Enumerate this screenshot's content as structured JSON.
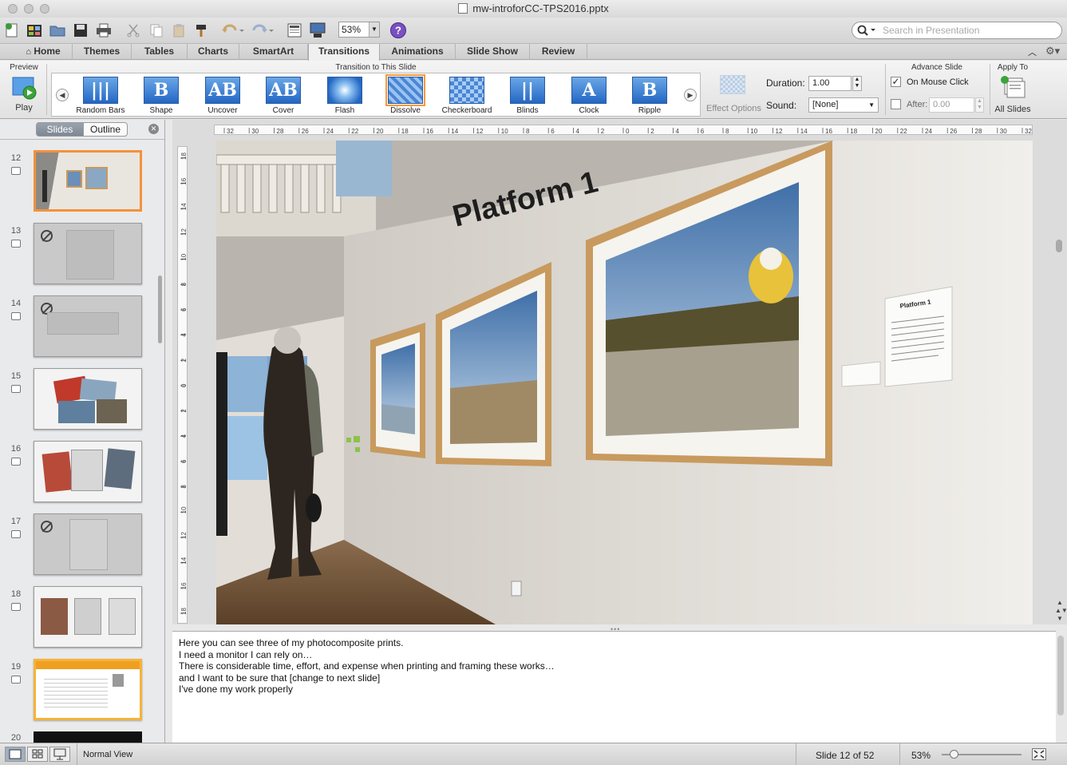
{
  "window": {
    "title": "mw-introforCC-TPS2016.pptx"
  },
  "toolbar": {
    "zoom": "53%",
    "search_placeholder": "Search in Presentation"
  },
  "tabs": [
    "Home",
    "Themes",
    "Tables",
    "Charts",
    "SmartArt",
    "Transitions",
    "Animations",
    "Slide Show",
    "Review"
  ],
  "active_tab": "Transitions",
  "ribbon": {
    "preview_label": "Preview",
    "play_label": "Play",
    "gallery_label": "Transition to This Slide",
    "transitions": [
      "Random Bars",
      "Shape",
      "Uncover",
      "Cover",
      "Flash",
      "Dissolve",
      "Checkerboard",
      "Blinds",
      "Clock",
      "Ripple"
    ],
    "selected_transition": "Dissolve",
    "effect_options_label": "Effect Options",
    "duration_label": "Duration:",
    "duration_value": "1.00",
    "sound_label": "Sound:",
    "sound_value": "[None]",
    "advance_label": "Advance Slide",
    "on_mouse_click_label": "On Mouse Click",
    "on_mouse_click_checked": true,
    "after_label": "After:",
    "after_value": "0.00",
    "after_checked": false,
    "apply_to_label": "Apply To",
    "all_slides_label": "All Slides"
  },
  "left_pane": {
    "slides_tab": "Slides",
    "outline_tab": "Outline",
    "slide_numbers": [
      "12",
      "13",
      "14",
      "15",
      "16",
      "17",
      "18",
      "19",
      "20"
    ],
    "selected_slide": "12"
  },
  "slide": {
    "wall_title": "Platform 1",
    "card_title": "Platform 1"
  },
  "ruler": {
    "h_ticks": [
      "32",
      "30",
      "28",
      "26",
      "24",
      "22",
      "20",
      "18",
      "16",
      "14",
      "12",
      "10",
      "8",
      "6",
      "4",
      "2",
      "0",
      "2",
      "4",
      "6",
      "8",
      "10",
      "12",
      "14",
      "16",
      "18",
      "20",
      "22",
      "24",
      "26",
      "28",
      "30",
      "32"
    ],
    "v_ticks": [
      "18",
      "16",
      "14",
      "12",
      "10",
      "8",
      "6",
      "4",
      "2",
      "0",
      "2",
      "4",
      "6",
      "8",
      "10",
      "12",
      "14",
      "16",
      "18"
    ]
  },
  "notes": [
    "Here you can see three of my photocomposite prints.",
    "I need a monitor I can rely on…",
    "There is considerable time, effort, and expense when printing and framing these works…",
    "and I want to be sure that [change to next slide]",
    "I've done my work properly"
  ],
  "status": {
    "view_name": "Normal View",
    "slide_position": "Slide 12 of 52",
    "zoom": "53%"
  },
  "colors": {
    "accent": "#f59a3a",
    "transition_blue": "#2367c4"
  }
}
